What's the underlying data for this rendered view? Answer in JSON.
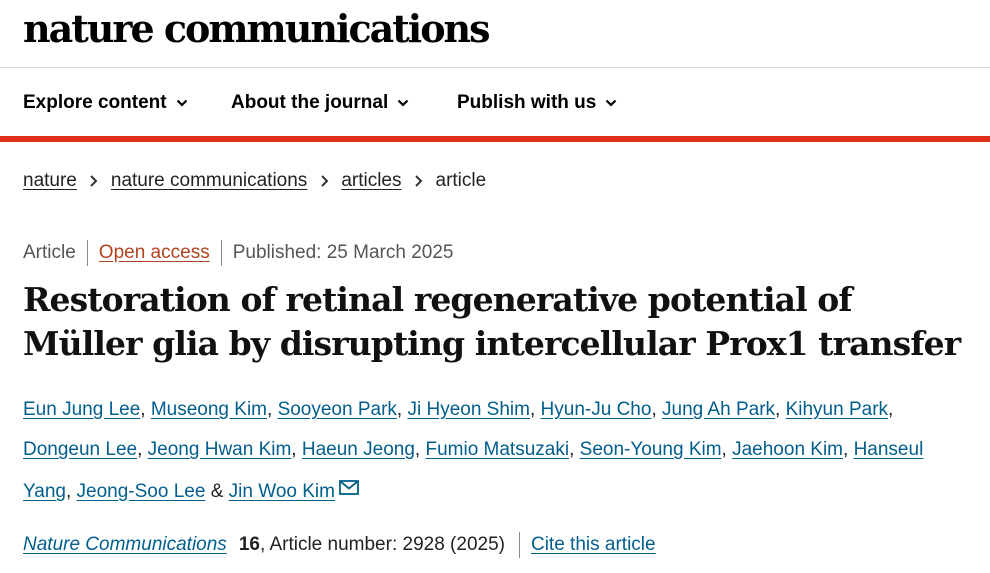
{
  "header": {
    "logo_text": "nature communications"
  },
  "nav": {
    "items": [
      {
        "label": "Explore content",
        "icon": "chevron-down-icon"
      },
      {
        "label": "About the journal",
        "icon": "chevron-down-icon"
      },
      {
        "label": "Publish with us",
        "icon": "chevron-down-icon"
      }
    ]
  },
  "breadcrumb": {
    "items": [
      "nature",
      "nature communications",
      "articles"
    ],
    "current": "article",
    "separator_icon": "chevron-right-icon"
  },
  "article": {
    "type": "Article",
    "access": "Open access",
    "published": "Published: 25 March 2025",
    "title": "Restoration of retinal regenerative potential of Müller glia by disrupting intercellular Prox1 transfer",
    "authors": [
      "Eun Jung Lee",
      "Museong Kim",
      "Sooyeon Park",
      "Ji Hyeon Shim",
      "Hyun-Ju Cho",
      "Jung Ah Park",
      "Kihyun Park",
      "Dongeun Lee",
      "Jeong Hwan Kim",
      "Haeun Jeong",
      "Fumio Matsuzaki",
      "Seon-Young Kim",
      "Jaehoon Kim",
      "Hanseul Yang",
      "Jeong-Soo Lee",
      "Jin Woo Kim"
    ],
    "author_final_conjunction": "&",
    "corresponding_icon": "envelope-icon",
    "citation": {
      "journal": "Nature Communications",
      "volume": "16",
      "article_number": ", Article number: 2928 (2025)",
      "cite_link": "Cite this article"
    }
  },
  "colors": {
    "accent_red": "#e0311f",
    "link_blue": "#025e8d",
    "open_access": "#b2431e"
  }
}
